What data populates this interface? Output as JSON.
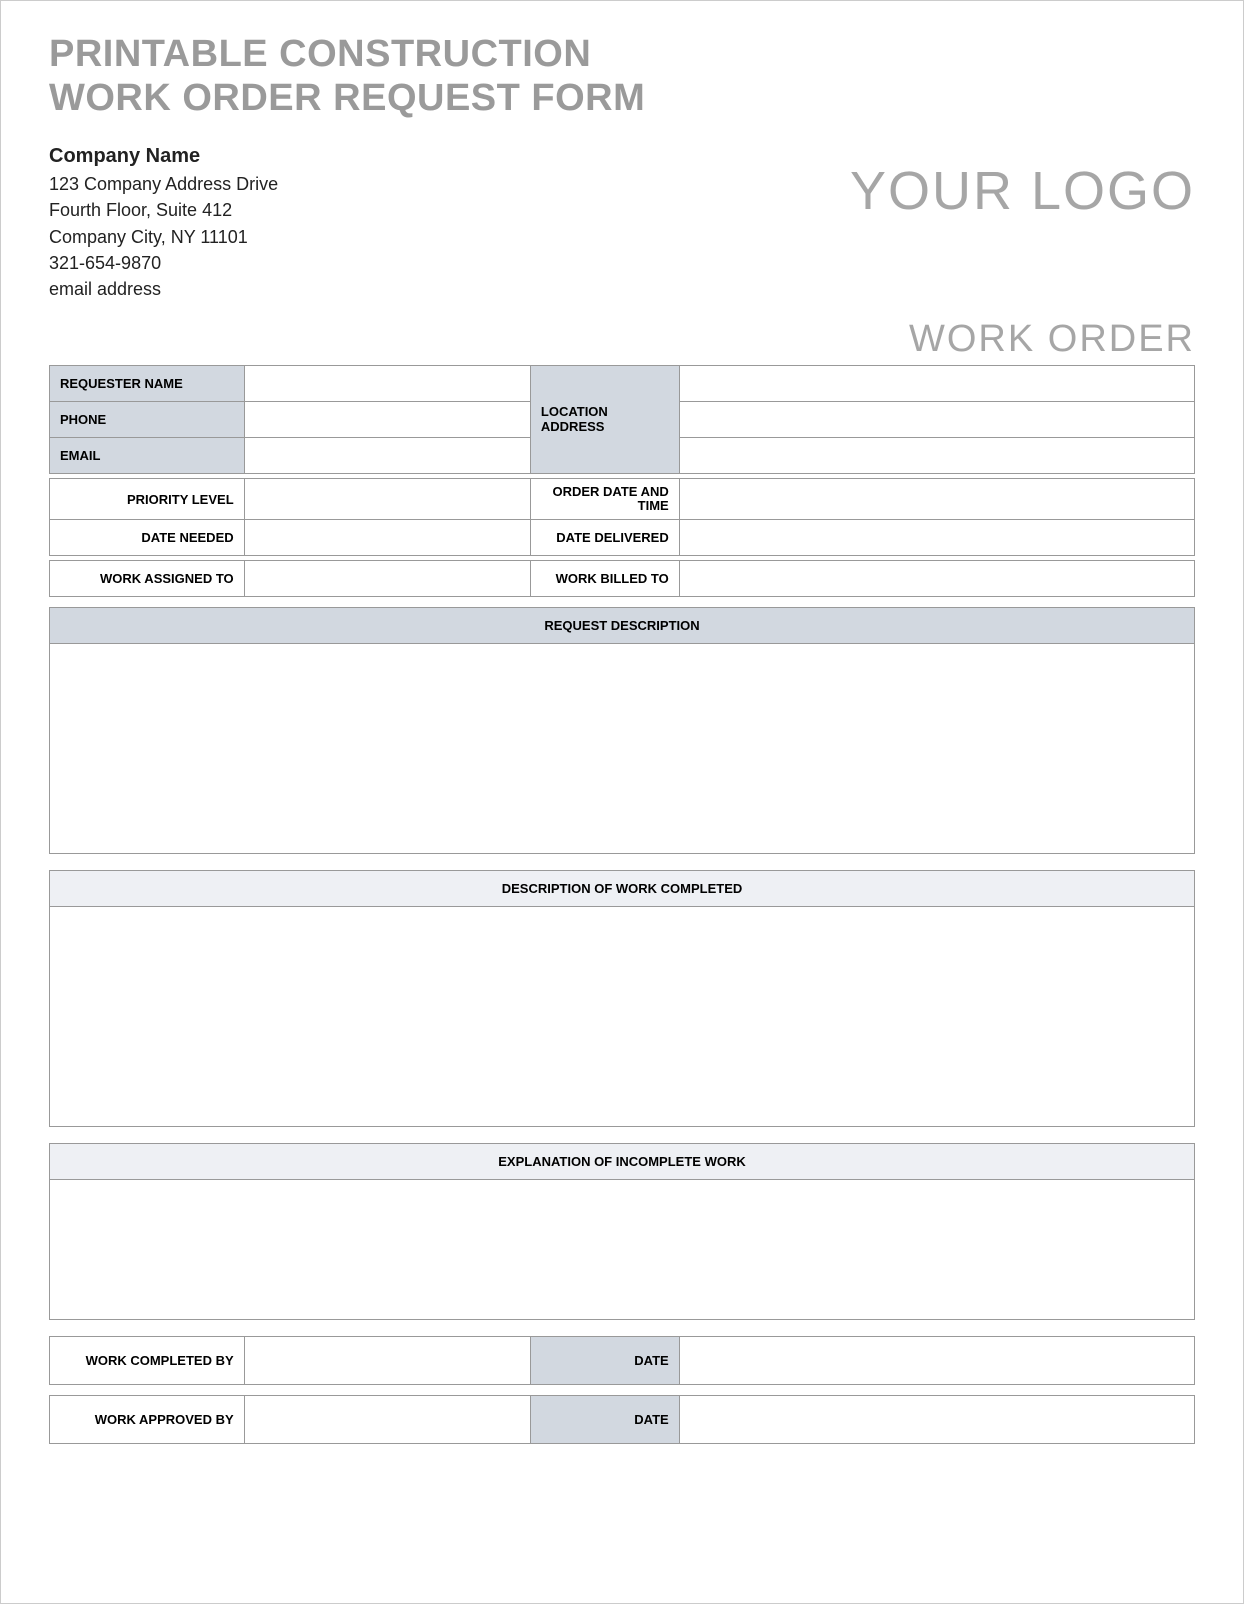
{
  "title_line1": "PRINTABLE CONSTRUCTION",
  "title_line2": "WORK ORDER REQUEST FORM",
  "company": {
    "name": "Company Name",
    "address1": "123 Company Address Drive",
    "address2": "Fourth Floor, Suite 412",
    "city_line": "Company City, NY  11101",
    "phone": "321-654-9870",
    "email": "email address"
  },
  "logo_text": "YOUR LOGO",
  "work_order_label": "WORK ORDER",
  "labels": {
    "requester_name": "REQUESTER NAME",
    "phone": "PHONE",
    "email": "EMAIL",
    "location_address": "LOCATION ADDRESS",
    "priority_level": "PRIORITY LEVEL",
    "order_date_time": "ORDER DATE AND TIME",
    "date_needed": "DATE NEEDED",
    "date_delivered": "DATE DELIVERED",
    "work_assigned_to": "WORK ASSIGNED TO",
    "work_billed_to": "WORK BILLED TO",
    "request_description": "REQUEST DESCRIPTION",
    "description_completed": "DESCRIPTION OF WORK COMPLETED",
    "explanation_incomplete": "EXPLANATION OF INCOMPLETE WORK",
    "work_completed_by": "WORK COMPLETED BY",
    "work_approved_by": "WORK APPROVED BY",
    "date": "DATE"
  },
  "values": {
    "requester_name": "",
    "phone": "",
    "email": "",
    "location_address_1": "",
    "location_address_2": "",
    "location_address_3": "",
    "priority_level": "",
    "order_date_time": "",
    "date_needed": "",
    "date_delivered": "",
    "work_assigned_to": "",
    "work_billed_to": "",
    "request_description": "",
    "description_completed": "",
    "explanation_incomplete": "",
    "work_completed_by": "",
    "completed_date": "",
    "work_approved_by": "",
    "approved_date": ""
  }
}
